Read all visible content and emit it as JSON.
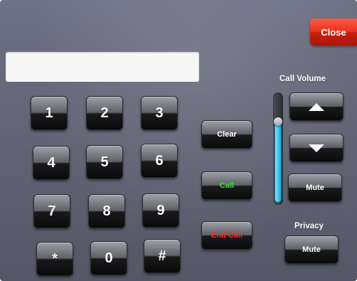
{
  "header": {
    "close_label": "Close"
  },
  "dialer": {
    "number_value": "",
    "keys": [
      "1",
      "2",
      "3",
      "4",
      "5",
      "6",
      "7",
      "8",
      "9",
      "*",
      "0",
      "#"
    ]
  },
  "actions": {
    "clear_label": "Clear",
    "call_label": "Call",
    "end_call_label": "End Call"
  },
  "volume": {
    "title": "Call Volume",
    "level_fraction": 0.75,
    "up_icon": "arrow-up-icon",
    "down_icon": "arrow-down-icon",
    "mute_label": "Mute"
  },
  "privacy": {
    "title": "Privacy",
    "mute_label": "Mute"
  },
  "colors": {
    "close_red": "#e8321f",
    "call_green": "#3ddb3a",
    "end_call_red": "#ff2a1e",
    "volume_fill": "#1aa7dd"
  }
}
